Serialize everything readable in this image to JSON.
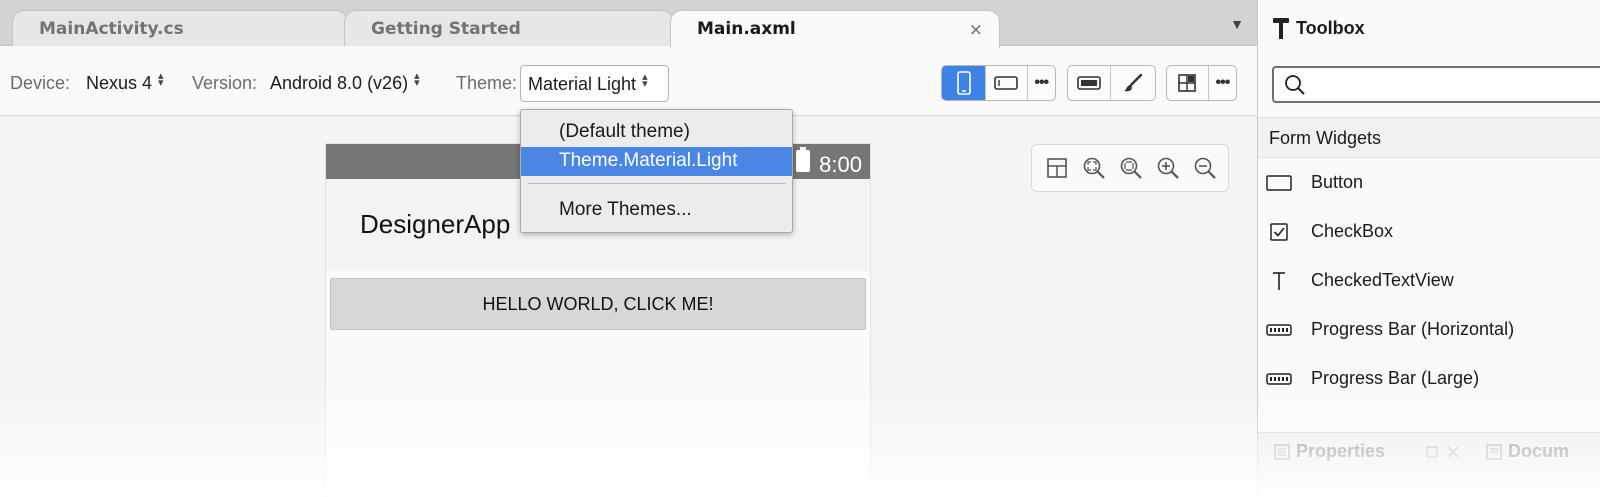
{
  "tabs": [
    {
      "label": "MainActivity.cs"
    },
    {
      "label": "Getting Started"
    },
    {
      "label": "Main.axml",
      "active": true
    }
  ],
  "tab_close_symbol": "×",
  "tab_overflow_symbol": "▼",
  "toolbar": {
    "device_label": "Device:",
    "device_value": "Nexus 4",
    "version_label": "Version:",
    "version_value": "Android 8.0 (v26)",
    "theme_label": "Theme:",
    "theme_value": "Material Light",
    "more_symbol": "•••"
  },
  "theme_menu": {
    "items": [
      "(Default theme)",
      "Theme.Material.Light",
      "More Themes..."
    ],
    "selected": "Theme.Material.Light"
  },
  "device_preview": {
    "status_time": "8:00",
    "app_title": "DesignerApp",
    "button_text": "HELLO WORLD, CLICK ME!"
  },
  "zoom_controls": [
    "layout-icon",
    "zoom-fit-icon",
    "zoom-actual-icon",
    "zoom-in-icon",
    "zoom-out-icon"
  ],
  "toolbox": {
    "title": "Toolbox",
    "search_placeholder": "",
    "category": "Form Widgets",
    "items": [
      {
        "label": "Button",
        "icon": "button-icon"
      },
      {
        "label": "CheckBox",
        "icon": "checkbox-icon"
      },
      {
        "label": "CheckedTextView",
        "icon": "text-icon"
      },
      {
        "label": "Progress Bar (Horizontal)",
        "icon": "progress-bar-icon"
      },
      {
        "label": "Progress Bar (Large)",
        "icon": "progress-bar-icon"
      }
    ]
  },
  "bottom_panel_tabs": [
    {
      "label": "Properties"
    },
    {
      "label": "Docum"
    }
  ],
  "colors": {
    "accent": "#4a86e4",
    "selected_toggle": "#3e83e4",
    "status_bar": "#767676"
  }
}
